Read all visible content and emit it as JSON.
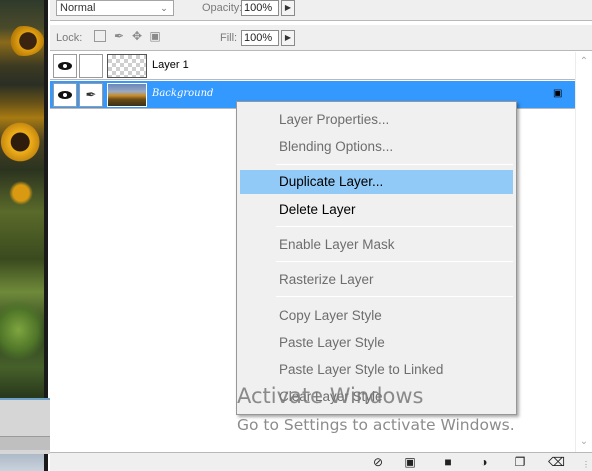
{
  "toolbar": {
    "blend_mode": "Normal",
    "opacity_label": "Opacity:",
    "opacity_value": "100%",
    "lock_label": "Lock:",
    "fill_label": "Fill:",
    "fill_value": "100%"
  },
  "icons": {
    "chevron": "chevron-down-icon",
    "arrow": "arrow-right-icon",
    "lock_transparent": "lock-transparent-pixels-icon",
    "lock_image": "brush-icon",
    "lock_position": "move-icon",
    "lock_all": "lock-icon",
    "eye": "eye-icon",
    "link": "brush-icon"
  },
  "layers": [
    {
      "name": "Layer 1",
      "selected": false,
      "locked": false
    },
    {
      "name": "Background",
      "selected": true,
      "locked": true
    }
  ],
  "context_menu": {
    "items": [
      {
        "label": "Layer Properties...",
        "enabled": false
      },
      {
        "label": "Blending Options...",
        "enabled": false
      },
      {
        "label": "Duplicate Layer...",
        "enabled": true,
        "highlighted": true
      },
      {
        "label": "Delete Layer",
        "enabled": true
      },
      {
        "label": "Enable Layer Mask",
        "enabled": false
      },
      {
        "label": "Rasterize Layer",
        "enabled": false
      },
      {
        "label": "Copy Layer Style",
        "enabled": false
      },
      {
        "label": "Paste Layer Style",
        "enabled": false
      },
      {
        "label": "Paste Layer Style to Linked",
        "enabled": false
      },
      {
        "label": "Clear Layer Style",
        "enabled": false
      }
    ]
  },
  "watermark": {
    "title": "Activate Windows",
    "subtitle": "Go to Settings to activate Windows."
  },
  "colors": {
    "selection": "#3399ff",
    "menu_highlight": "#91c9f7",
    "panel_bg": "#efefef"
  }
}
